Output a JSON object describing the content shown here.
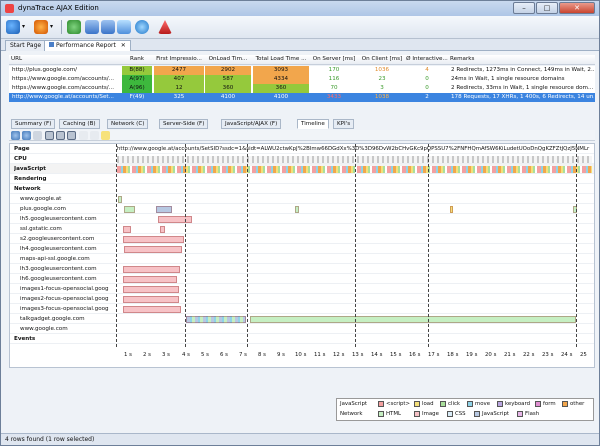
{
  "window": {
    "title": "dynaTrace AJAX Edition",
    "min": "–",
    "max": "□",
    "close": "✕"
  },
  "doc_tabs": [
    {
      "label": "Start Page"
    },
    {
      "label": "Performance Report",
      "close": "✕"
    }
  ],
  "grid": {
    "columns": [
      "URL",
      "Rank",
      "First Impressio...",
      "OnLoad Tim...",
      "Total Load Time ...",
      "On Server [ms]",
      "On Client [ms]",
      "Ø Interactive...",
      "Remarks"
    ],
    "rows": [
      {
        "url": "http://plus.google.com/",
        "rank": "B(88)",
        "first": "2477",
        "onload": "2902",
        "total": "3093",
        "server": "170",
        "client": "1036",
        "interactive": "4",
        "remarks": "2 Redirects, 1273ms in Connect, 149ms in Wait, 2..."
      },
      {
        "url": "https://www.google.com/accounts/...",
        "rank": "A(97)",
        "first": "407",
        "onload": "587",
        "total": "4334",
        "server": "116",
        "client": "23",
        "interactive": "0",
        "remarks": "24ms in Wait, 1 single resource domains"
      },
      {
        "url": "https://www.google.com/accounts/...",
        "rank": "A(96)",
        "first": "12",
        "onload": "360",
        "total": "360",
        "server": "70",
        "client": "3",
        "interactive": "0",
        "remarks": "2 Redirects, 33ms in Wait, 1 single resource dom..."
      },
      {
        "url": "http://www.google.at/accounts/Set...",
        "rank": "F(49)",
        "first": "325",
        "onload": "4100",
        "total": "4100",
        "server": "3433",
        "client": "1038",
        "interactive": "2",
        "remarks": "178 Requests, 17 XHRs, 1 400s, 6 Redirects, 14 un..."
      }
    ]
  },
  "sub_tabs": [
    {
      "label": "Summary (F)"
    },
    {
      "label": "Caching (B)"
    },
    {
      "label": "Network (C)"
    },
    {
      "label": "Server-Side (F)"
    },
    {
      "label": "JavaScript/AJAX (F)"
    },
    {
      "label": "Timeline"
    },
    {
      "label": "KPI's"
    }
  ],
  "timeline": {
    "page_url": "http://www.google.at/accounts/SetSID?ssdc=1&sidt=ALWU2ctwKpJ%2BImw66DGdXx%3D%3D96DvW2bCHvGKc9pQPSSU7%2FNFHQmAfSW6KiLudetUOoDnQgKZFZtJQzJ5NMLr",
    "rows": [
      "Page",
      "CPU",
      "JavaScript",
      "Rendering",
      "Network",
      "www.google.at",
      "plus.google.com",
      "lh5.googleusercontent.com",
      "ssl.gstatic.com",
      "s2.googleusercontent.com",
      "lh4.googleusercontent.com",
      "maps-api-ssl.google.com",
      "lh3.googleusercontent.com",
      "lh6.googleusercontent.com",
      "images1-focus-opensocial.goog",
      "images2-focus-opensocial.goog",
      "images3-focus-opensocial.goog",
      "talkgadget.google.com",
      "www.google.com",
      "Events"
    ],
    "ticks": [
      "1 s",
      "2 s",
      "3 s",
      "4 s",
      "5 s",
      "6 s",
      "7 s",
      "8 s",
      "9 s",
      "10 s",
      "11 s",
      "12 s",
      "13 s",
      "14 s",
      "15 s",
      "16 s",
      "17 s",
      "18 s",
      "19 s",
      "20 s",
      "21 s",
      "22 s",
      "23 s",
      "24 s",
      "25"
    ]
  },
  "legend": {
    "js_label": "JavaScript",
    "js_items": [
      {
        "label": "<script>",
        "color": "#f4a0a0"
      },
      {
        "label": "load",
        "color": "#f5e07a"
      },
      {
        "label": "click",
        "color": "#a9df9b"
      },
      {
        "label": "move",
        "color": "#8fd3e8"
      },
      {
        "label": "keyboard",
        "color": "#b9a6e0"
      },
      {
        "label": "form",
        "color": "#e08fd1"
      },
      {
        "label": "other",
        "color": "#f2a64c"
      }
    ],
    "net_label": "Network",
    "net_items": [
      {
        "label": "HTML",
        "color": "#c6efc2"
      },
      {
        "label": "Image",
        "color": "#f7c2c6"
      },
      {
        "label": "CSS",
        "color": "#d9ecf7"
      },
      {
        "label": "JavaScript",
        "color": "#b7c8e2"
      },
      {
        "label": "Flash",
        "color": "#e7b6e8"
      }
    ]
  },
  "status": {
    "text": "4 rows found (1 row selected)"
  },
  "colors": {
    "rank_good": "#3db83d",
    "rank_ok": "#95c93c",
    "rank_bad": "#e23a3a",
    "orange": "#f2a64c",
    "selected": "#3b84e0"
  }
}
